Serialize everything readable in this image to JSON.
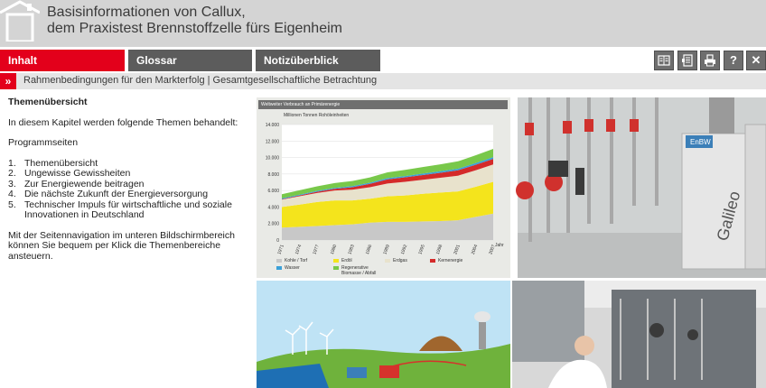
{
  "header": {
    "title_line1": "Basisinformationen von Callux,",
    "title_line2": "dem Praxistest Brennstoffzelle fürs Eigenheim"
  },
  "nav": {
    "tabs": [
      {
        "label": "Inhalt",
        "active": true
      },
      {
        "label": "Glossar",
        "active": false
      },
      {
        "label": "Notizüberblick",
        "active": false
      }
    ],
    "tools": [
      "book-icon",
      "notes-icon",
      "print-icon",
      "help-icon",
      "close-icon"
    ],
    "tool_glyphs": {
      "help": "?",
      "close": "✕"
    }
  },
  "breadcrumb": {
    "arrow": "»",
    "text": "Rahmenbedingungen für den Markterfolg | Gesamtgesellschaftliche Betrachtung"
  },
  "content": {
    "heading": "Themenübersicht",
    "intro": "In diesem Kapitel werden folgende Themen behandelt:",
    "subheading": "Programmseiten",
    "items": [
      {
        "num": "1.",
        "text": "Themenübersicht"
      },
      {
        "num": "2.",
        "text": "Ungewisse Gewissheiten"
      },
      {
        "num": "3.",
        "text": "Zur Energiewende beitragen"
      },
      {
        "num": "4.",
        "text": "Die nächste Zukunft der Energieversorgung"
      },
      {
        "num": "5.",
        "text": "Technischer Impuls für wirtschaftliche und soziale Innovationen in Deutschland"
      }
    ],
    "outro": "Mit der Seitennavigation im unteren Bildschirmbereich können Sie bequem per Klick die Themenbereiche ansteuern."
  },
  "colors": {
    "accent_red": "#e3001b",
    "tab_gray": "#5c5c5c",
    "header_gray": "#d4d4d4"
  },
  "chart_data": {
    "type": "area",
    "title": "Weltweiter Verbrauch an Primärenergie",
    "ylabel": "Millionen Tonnen Rohöleinheiten",
    "xlabel": "Jahr",
    "ylim": [
      0,
      14000
    ],
    "yticks": [
      "0",
      "2.000",
      "4.000",
      "6.000",
      "8.000",
      "10.000",
      "12.000",
      "14.000"
    ],
    "x": [
      "1971",
      "1974",
      "1977",
      "1980",
      "1983",
      "1986",
      "1989",
      "1992",
      "1995",
      "1998",
      "2001",
      "2004",
      "2007"
    ],
    "series": [
      {
        "name": "Kohle / Torf",
        "color": "#c8c8c8",
        "values": [
          1500,
          1600,
          1700,
          1800,
          1900,
          2100,
          2200,
          2200,
          2250,
          2300,
          2400,
          2800,
          3200
        ]
      },
      {
        "name": "Erdöl",
        "color": "#f4e41c",
        "values": [
          2500,
          2700,
          2900,
          3000,
          2900,
          2900,
          3100,
          3200,
          3350,
          3450,
          3500,
          3650,
          3850
        ]
      },
      {
        "name": "Erdgas",
        "color": "#e8e2cc",
        "values": [
          900,
          1000,
          1100,
          1200,
          1300,
          1400,
          1550,
          1650,
          1700,
          1800,
          1900,
          2000,
          2100
        ]
      },
      {
        "name": "Kernenergie",
        "color": "#d42a2a",
        "values": [
          50,
          100,
          150,
          200,
          300,
          400,
          500,
          550,
          580,
          600,
          650,
          670,
          680
        ]
      },
      {
        "name": "Wasser",
        "color": "#3aa0d8",
        "values": [
          100,
          105,
          110,
          120,
          130,
          140,
          150,
          160,
          170,
          180,
          190,
          200,
          220
        ]
      },
      {
        "name": "Regenerative",
        "color": "#78c84a",
        "values": [
          500,
          520,
          550,
          580,
          620,
          650,
          700,
          750,
          800,
          850,
          900,
          950,
          1000
        ]
      }
    ],
    "legend": [
      "Kohle / Torf",
      "Erdöl",
      "Erdgas",
      "Kernenergie",
      "Wasser",
      "Regenerative"
    ],
    "legend_note": "Biomasse / Abfall",
    "grid": true,
    "legend_position": "bottom"
  }
}
